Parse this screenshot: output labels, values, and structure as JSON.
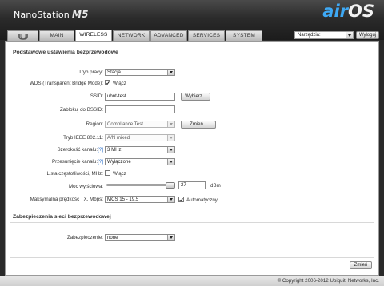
{
  "header": {
    "brand_name": "NanoStation",
    "brand_model": "M5",
    "logo_air": "air",
    "logo_os": "OS"
  },
  "tabs": [
    {
      "label": "",
      "icon": "ubiquiti-logo-icon"
    },
    {
      "label": "MAIN"
    },
    {
      "label": "WIRELESS",
      "active": true
    },
    {
      "label": "NETWORK"
    },
    {
      "label": "ADVANCED"
    },
    {
      "label": "SERVICES"
    },
    {
      "label": "SYSTEM"
    }
  ],
  "toolbar": {
    "tools_select": "Narzędzia:",
    "logout_label": "Wyloguj"
  },
  "basic": {
    "title": "Podstawowe ustawienia bezprzewodowe",
    "mode_label": "Tryb pracy:",
    "mode_value": "Stacja",
    "wds_label": "WDS (Transparent Bridge Mode):",
    "wds_checked": true,
    "wds_option": "Włącz",
    "ssid_label": "SSID:",
    "ssid_value": "ubnt-test",
    "select_ssid_button": "Wybierz...",
    "lock_bssid_label": "Zablokuj do BSSID:",
    "lock_bssid_value": "",
    "region_label": "Region:",
    "region_value": "Compliance Test",
    "change_button": "Zmień...",
    "ieee_label": "Tryb IEEE 802.11:",
    "ieee_value": "A/N mixed",
    "channel_width_label": "Szerokość kanału:",
    "channel_width_help": "[?]",
    "channel_width_value": "3 MHz",
    "channel_shift_label": "Przesunięcie kanału:",
    "channel_shift_help": "[?]",
    "channel_shift_value": "Wyłączone",
    "freq_list_label": "Lista częstotliwości, MHz:",
    "freq_list_checked": false,
    "freq_list_option": "Włącz",
    "output_power_label": "Moc wyjściowa:",
    "output_power_value": "27",
    "output_power_unit": "dBm",
    "output_power_level": 0.93,
    "max_rate_label": "Maksymalna prędkość TX, Mbps:",
    "max_rate_value": "MCS 15 - 19.5",
    "auto_checked": true,
    "auto_label": "Automatyczny"
  },
  "security": {
    "title": "Zabezpieczenia sieci bezprzewodowej",
    "security_label": "Zabezpieczenie:",
    "security_value": "none"
  },
  "actions": {
    "change_label": "Zmień"
  },
  "footer": {
    "copyright": "© Copyright 2006-2012 Ubiquiti Networks, Inc."
  },
  "colors": {
    "accent_blue": "#3ea9f5",
    "header_dark": "#1c1c1c"
  }
}
